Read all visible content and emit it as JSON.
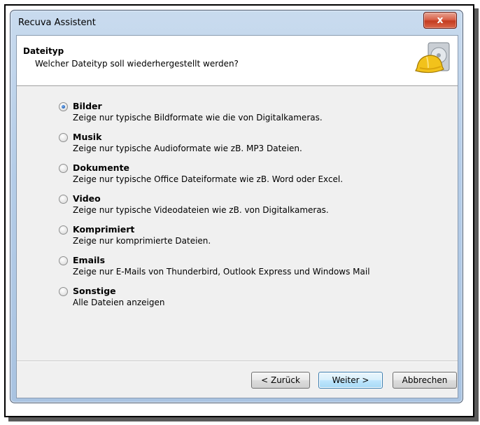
{
  "window": {
    "title": "Recuva Assistent"
  },
  "header": {
    "title": "Dateityp",
    "subtitle": "Welcher Dateityp soll wiederhergestellt werden?",
    "icon": "recuva-hardhat-disk-icon"
  },
  "options": [
    {
      "label": "Bilder",
      "description": "Zeige nur typische Bildformate wie die von Digitalkameras.",
      "checked": true
    },
    {
      "label": "Musik",
      "description": "Zeige nur typische Audioformate wie zB. MP3 Dateien.",
      "checked": false
    },
    {
      "label": "Dokumente",
      "description": "Zeige nur typische Office Dateiformate wie zB. Word oder Excel.",
      "checked": false
    },
    {
      "label": "Video",
      "description": "Zeige nur typische Videodateien wie zB. von Digitalkameras.",
      "checked": false
    },
    {
      "label": "Komprimiert",
      "description": "Zeige nur komprimierte Dateien.",
      "checked": false
    },
    {
      "label": "Emails",
      "description": "Zeige nur E-Mails von Thunderbird, Outlook Express und Windows Mail",
      "checked": false
    },
    {
      "label": "Sonstige",
      "description": "Alle Dateien anzeigen",
      "checked": false
    }
  ],
  "buttons": {
    "back": "< Zurück",
    "next": "Weiter >",
    "cancel": "Abbrechen",
    "close_glyph": "x"
  }
}
